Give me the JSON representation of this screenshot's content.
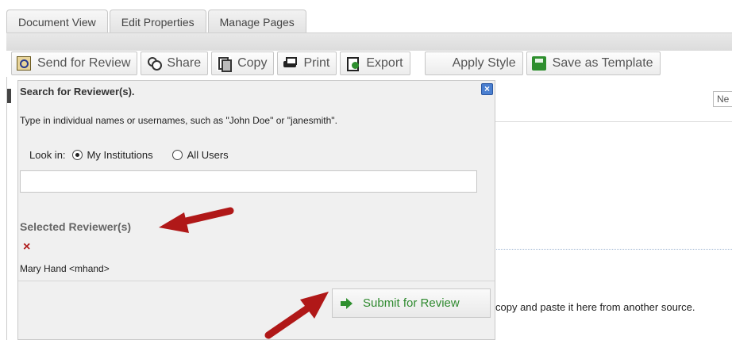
{
  "tabs": [
    {
      "label": "Document View"
    },
    {
      "label": "Edit Properties"
    },
    {
      "label": "Manage Pages"
    }
  ],
  "toolbar": {
    "send_for_review": "Send for Review",
    "share": "Share",
    "copy": "Copy",
    "print": "Print",
    "export": "Export",
    "apply_style": "Apply Style",
    "save_as_template": "Save as Template"
  },
  "background": {
    "field_partial": "Ne",
    "paste_hint": "copy and paste it here from another source."
  },
  "dialog": {
    "title": "Search for Reviewer(s).",
    "close_icon": "x-icon",
    "instructions": "Type in individual names or usernames, such as \"John Doe\" or \"janesmith\".",
    "look_in_label": "Look in:",
    "options": [
      {
        "label": "My Institutions",
        "selected": true
      },
      {
        "label": "All Users",
        "selected": false
      }
    ],
    "search_value": "",
    "selected_label": "Selected Reviewer(s)",
    "remove_icon": "×",
    "reviewers": [
      {
        "name": "Mary Hand <mhand>"
      }
    ],
    "submit_label": "Submit for Review"
  },
  "colors": {
    "submit_text": "#2f8a2f",
    "arrow": "#b01818",
    "close_button": "#4a7fd0"
  }
}
